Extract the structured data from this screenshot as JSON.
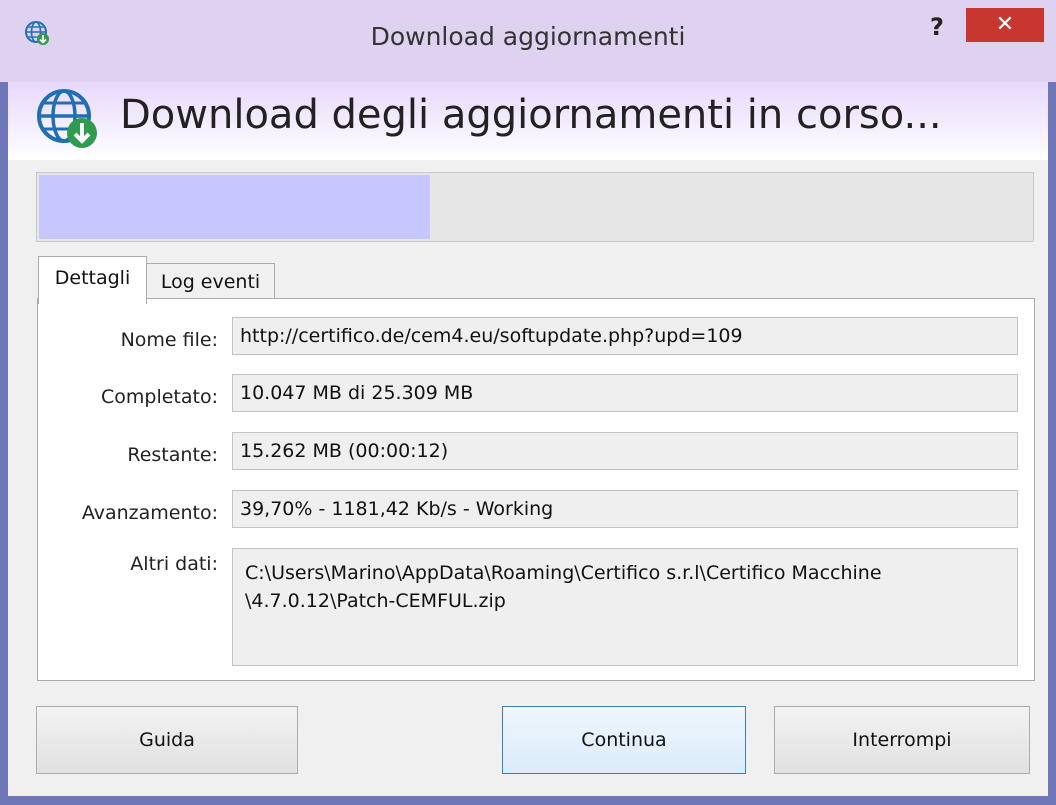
{
  "window": {
    "title": "Download aggiornamenti",
    "help_label": "?",
    "close_label": "✕"
  },
  "header": {
    "heading": "Download degli aggiornamenti in corso..."
  },
  "progress": {
    "fraction": 0.397
  },
  "tabs": [
    {
      "label": "Dettagli",
      "selected": true
    },
    {
      "label": "Log eventi",
      "selected": false
    }
  ],
  "details": {
    "nome_file_label": "Nome file:",
    "nome_file_value": "http://certifico.de/cem4.eu/softupdate.php?upd=109",
    "completato_label": "Completato:",
    "completato_value": "10.047 MB di 25.309 MB",
    "restante_label": "Restante:",
    "restante_value": "15.262 MB (00:00:12)",
    "avanzamento_label": "Avanzamento:",
    "avanzamento_value": "39,70% - 1181,42 Kb/s - Working",
    "altri_dati_label": "Altri dati:",
    "altri_dati_line1": "C:\\Users\\Marino\\AppData\\Roaming\\Certifico s.r.l\\Certifico Macchine",
    "altri_dati_line2": "\\4.7.0.12\\Patch-CEMFUL.zip"
  },
  "buttons": {
    "guida": "Guida",
    "continua": "Continua",
    "interrompi": "Interrompi"
  },
  "colors": {
    "titlebar": "#dfd2f1",
    "close_button": "#c7372f",
    "progress_fill": "#c8c6ff",
    "icon_blue": "#1f6fb5",
    "icon_green": "#2e9b4e"
  }
}
